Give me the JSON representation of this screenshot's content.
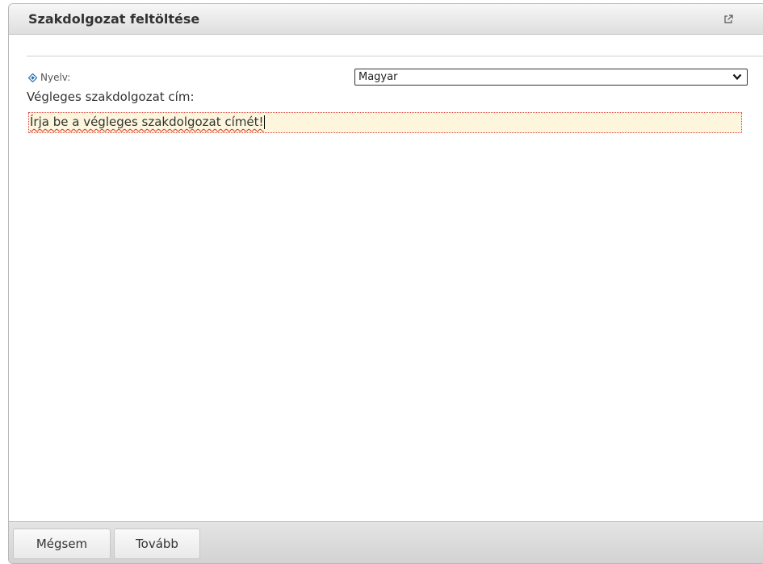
{
  "dialog": {
    "title": "Szakdolgozat feltöltése",
    "popout_icon": "popout-icon"
  },
  "form": {
    "language_label": "Nyelv:",
    "language_icon": "diamond-icon",
    "language_selected": "Magyar",
    "thesis_title_label": "Végleges szakdolgozat cím:",
    "thesis_title_value": "Írja be a végleges szakdolgozat címét!"
  },
  "footer": {
    "cancel_label": "Mégsem",
    "next_label": "Tovább"
  },
  "colors": {
    "accent_icon": "#2a6fb0",
    "input_background": "#fdf6dc",
    "input_border": "#e04040"
  }
}
